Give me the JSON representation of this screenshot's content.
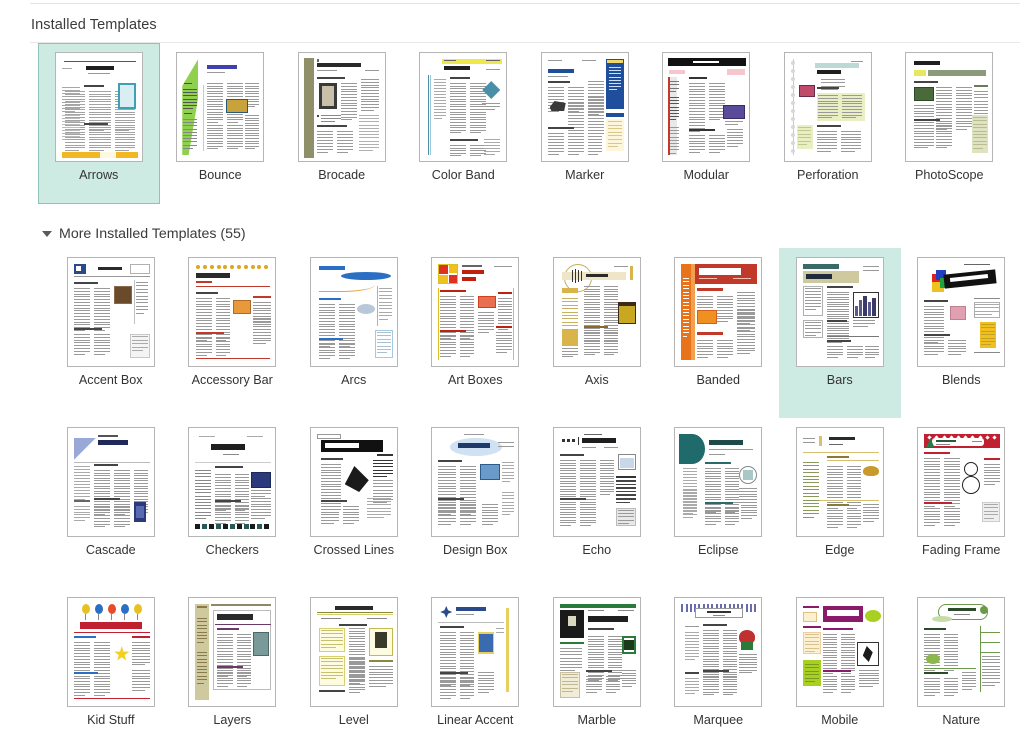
{
  "header": {
    "section_title": "Installed Templates"
  },
  "more_section": {
    "label": "More Installed Templates (55)",
    "count": 55,
    "expanded": true,
    "chevron_icon": "chevron-down-icon"
  },
  "colors": {
    "selection_fill": "#cdeae3",
    "selection_border": "#8fc3b8",
    "page_background": "#ffffff",
    "divider": "#e4e4e4",
    "label_text": "#333333",
    "thumb_border": "#b5b5b5"
  },
  "installed_templates": [
    {
      "name": "Arrows",
      "state": "selected"
    },
    {
      "name": "Bounce",
      "state": "normal"
    },
    {
      "name": "Brocade",
      "state": "normal"
    },
    {
      "name": "Color Band",
      "state": "normal"
    },
    {
      "name": "Marker",
      "state": "normal"
    },
    {
      "name": "Modular",
      "state": "normal"
    },
    {
      "name": "Perforation",
      "state": "normal"
    },
    {
      "name": "PhotoScope",
      "state": "normal"
    }
  ],
  "more_installed_templates": [
    {
      "name": "Accent Box",
      "state": "normal"
    },
    {
      "name": "Accessory Bar",
      "state": "normal"
    },
    {
      "name": "Arcs",
      "state": "normal"
    },
    {
      "name": "Art Boxes",
      "state": "normal"
    },
    {
      "name": "Axis",
      "state": "normal"
    },
    {
      "name": "Banded",
      "state": "normal"
    },
    {
      "name": "Bars",
      "state": "hovered"
    },
    {
      "name": "Blends",
      "state": "normal"
    },
    {
      "name": "Cascade",
      "state": "normal"
    },
    {
      "name": "Checkers",
      "state": "normal"
    },
    {
      "name": "Crossed Lines",
      "state": "normal"
    },
    {
      "name": "Design Box",
      "state": "normal"
    },
    {
      "name": "Echo",
      "state": "normal"
    },
    {
      "name": "Eclipse",
      "state": "normal"
    },
    {
      "name": "Edge",
      "state": "normal"
    },
    {
      "name": "Fading Frame",
      "state": "normal"
    },
    {
      "name": "Kid Stuff",
      "state": "normal"
    },
    {
      "name": "Layers",
      "state": "normal"
    },
    {
      "name": "Level",
      "state": "normal"
    },
    {
      "name": "Linear Accent",
      "state": "normal"
    },
    {
      "name": "Marble",
      "state": "normal"
    },
    {
      "name": "Marquee",
      "state": "normal"
    },
    {
      "name": "Mobile",
      "state": "normal"
    },
    {
      "name": "Nature",
      "state": "normal"
    }
  ],
  "thumbnail_styles": {
    "Arrows": {
      "accent": "#f2b823",
      "secondary": "#3e9fb5",
      "layout": "bottom-bar"
    },
    "Bounce": {
      "accent": "#8fd14f",
      "secondary": "#4040b0",
      "layout": "left-wedge"
    },
    "Brocade": {
      "accent": "#8a8a62",
      "secondary": "#555544",
      "layout": "left-band"
    },
    "Color Band": {
      "accent": "#e8e24a",
      "secondary": "#4a8fa8",
      "layout": "top-band"
    },
    "Marker": {
      "accent": "#1f4e9c",
      "secondary": "#f0d66a",
      "layout": "right-panel"
    },
    "Modular": {
      "accent": "#1a1a1a",
      "secondary": "#c0392b",
      "layout": "black-header"
    },
    "Perforation": {
      "accent": "#bcd9d6",
      "secondary": "#e4ebb8",
      "layout": "left-perf"
    },
    "PhotoScope": {
      "accent": "#8a9a7b",
      "secondary": "#dfe3c2",
      "layout": "green-bar"
    },
    "Accent Box": {
      "accent": "#2b4a8c",
      "secondary": "#8a6a4a",
      "layout": "boxed"
    },
    "Accessory Bar": {
      "accent": "#d6a22a",
      "secondary": "#c0392b",
      "layout": "dot-row"
    },
    "Arcs": {
      "accent": "#2b6fc4",
      "secondary": "#e8a33d",
      "layout": "arc"
    },
    "Art Boxes": {
      "accent": "#e03020",
      "secondary": "#f0c020",
      "layout": "color-squares"
    },
    "Axis": {
      "accent": "#d8b44a",
      "secondary": "#8a6a2a",
      "layout": "circle-axis"
    },
    "Banded": {
      "accent": "#e8731a",
      "secondary": "#b03010",
      "layout": "orange-band"
    },
    "Bars": {
      "accent": "#3a6a66",
      "secondary": "#cfc9a0",
      "layout": "chart"
    },
    "Blends": {
      "accent": "#1a1a1a",
      "secondary": "#f0c020",
      "layout": "black-banner"
    },
    "Cascade": {
      "accent": "#9aa8d8",
      "secondary": "#2b3a7a",
      "layout": "triangle"
    },
    "Checkers": {
      "accent": "#2a5a58",
      "secondary": "#1a2a5a",
      "layout": "checker-row"
    },
    "Crossed Lines": {
      "accent": "#111111",
      "secondary": "#444444",
      "layout": "black-title"
    },
    "Design Box": {
      "accent": "#a8c8e8",
      "secondary": "#2b5a8c",
      "layout": "burst"
    },
    "Echo": {
      "accent": "#3a3a3a",
      "secondary": "#9a9a9a",
      "layout": "mono-table"
    },
    "Eclipse": {
      "accent": "#1f6a6a",
      "secondary": "#a8c8c8",
      "layout": "quarter-circle"
    },
    "Edge": {
      "accent": "#d8c070",
      "secondary": "#8a9a5a",
      "layout": "rules"
    },
    "Fading Frame": {
      "accent": "#c02030",
      "secondary": "#2a7a4a",
      "layout": "red-frame"
    },
    "Kid Stuff": {
      "accent": "#e84a2a",
      "secondary": "#2b6fc4",
      "layout": "balloons"
    },
    "Layers": {
      "accent": "#cfc9a0",
      "secondary": "#6a3a6a",
      "layout": "side-panel"
    },
    "Level": {
      "accent": "#d8d070",
      "secondary": "#8a8a3a",
      "layout": "yellow-boxes"
    },
    "Linear Accent": {
      "accent": "#2b4a8c",
      "secondary": "#e8d060",
      "layout": "right-rule"
    },
    "Marble": {
      "accent": "#1a1a1a",
      "secondary": "#2a7a3a",
      "layout": "dark-photo"
    },
    "Marquee": {
      "accent": "#3a3a7a",
      "secondary": "#c03030",
      "layout": "marquee-top"
    },
    "Mobile": {
      "accent": "#8a1a6a",
      "secondary": "#a8d020",
      "layout": "magenta"
    },
    "Nature": {
      "accent": "#6a9a4a",
      "secondary": "#c8dca8",
      "layout": "oval"
    }
  }
}
